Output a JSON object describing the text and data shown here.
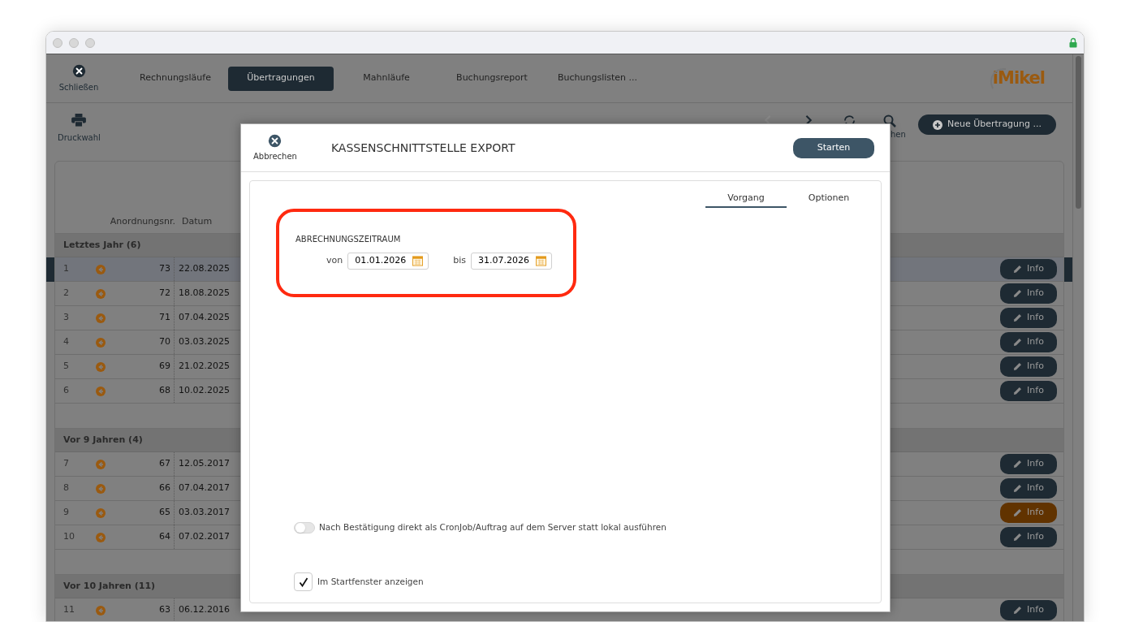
{
  "nav": {
    "close_label": "Schließen",
    "tabs": [
      {
        "label": "Rechnungsläufe",
        "selected": false
      },
      {
        "label": "Übertragungen",
        "selected": true
      },
      {
        "label": "Mahnläufe",
        "selected": false
      },
      {
        "label": "Buchungsreport",
        "selected": false
      },
      {
        "label": "Buchungslisten ...",
        "selected": false
      }
    ],
    "logo": "iMikel"
  },
  "toolbar": {
    "print_label": "Druckwahl",
    "search_label": "hen",
    "new_button": "Neue Übertragung ..."
  },
  "table": {
    "columns": [
      "Anordnungsnr.",
      "Datum"
    ],
    "groups": [
      {
        "title": "Letztes Jahr (6)",
        "rows": [
          {
            "index": "1",
            "number": "73",
            "date": "22.08.2025",
            "info": "Info",
            "selected": true,
            "highlighted": false
          },
          {
            "index": "2",
            "number": "72",
            "date": "18.08.2025",
            "info": "Info",
            "selected": false,
            "highlighted": false
          },
          {
            "index": "3",
            "number": "71",
            "date": "07.04.2025",
            "info": "Info",
            "selected": false,
            "highlighted": false
          },
          {
            "index": "4",
            "number": "70",
            "date": "03.03.2025",
            "info": "Info",
            "selected": false,
            "highlighted": false
          },
          {
            "index": "5",
            "number": "69",
            "date": "21.02.2025",
            "info": "Info",
            "selected": false,
            "highlighted": false
          },
          {
            "index": "6",
            "number": "68",
            "date": "10.02.2025",
            "info": "Info",
            "selected": false,
            "highlighted": false
          }
        ]
      },
      {
        "title": "Vor 9 Jahren (4)",
        "rows": [
          {
            "index": "7",
            "number": "67",
            "date": "12.05.2017",
            "info": "Info",
            "selected": false,
            "highlighted": false
          },
          {
            "index": "8",
            "number": "66",
            "date": "07.04.2017",
            "info": "Info",
            "selected": false,
            "highlighted": false
          },
          {
            "index": "9",
            "number": "65",
            "date": "03.03.2017",
            "info": "Info",
            "selected": false,
            "highlighted": true
          },
          {
            "index": "10",
            "number": "64",
            "date": "07.02.2017",
            "info": "Info",
            "selected": false,
            "highlighted": false
          }
        ]
      },
      {
        "title": "Vor 10 Jahren (11)",
        "rows": [
          {
            "index": "11",
            "number": "63",
            "date": "06.12.2016",
            "info": "Info",
            "selected": false,
            "highlighted": false
          }
        ]
      }
    ]
  },
  "dialog": {
    "cancel_label": "Abbrechen",
    "title": "KASSENSCHNITTSTELLE EXPORT",
    "start_button": "Starten",
    "tabs": [
      {
        "label": "Vorgang",
        "selected": true
      },
      {
        "label": "Optionen",
        "selected": false
      }
    ],
    "section": {
      "title": "ABRECHNUNGSZEITRAUM",
      "from_label": "von",
      "from_value": "01.01.2026",
      "to_label": "bis",
      "to_value": "31.07.2026"
    },
    "toggle": {
      "label": "Nach Bestätigung direkt als CronJob/Auftrag auf dem Server statt lokal ausführen",
      "on": false
    },
    "checkbox": {
      "label": "Im Startfenster anzeigen",
      "checked": true
    }
  }
}
